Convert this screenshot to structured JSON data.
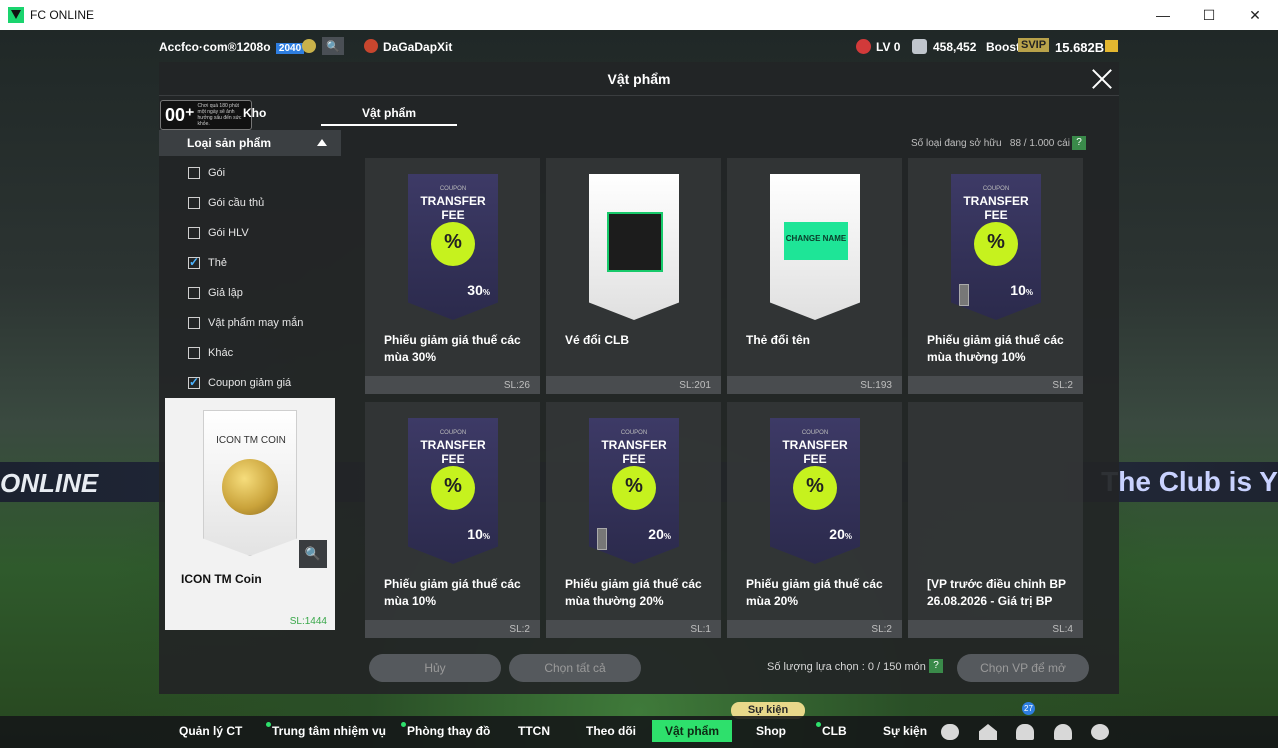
{
  "window": {
    "title": "FC ONLINE",
    "minimize": "—",
    "maximize": "☐",
    "close": "✕"
  },
  "background": {
    "banner_left": "ONLINE",
    "banner_right": "The Club is Y"
  },
  "topbar": {
    "account": "Accfco·com®1208o",
    "level_tag": "2040",
    "club": "DaGaDapXit",
    "lv": "LV 0",
    "mp": "458,452",
    "boost": "Boost",
    "svip": "SVIP",
    "coins": "15.682B"
  },
  "modal": {
    "title": "Vật phẩm",
    "age_rating": "00⁺",
    "age_notice": "Chơi quá 180 phút một ngày sẽ ảnh hưởng xấu đến sức khỏe.",
    "tab_kho": "Kho",
    "tab_vatpham": "Vật phẩm",
    "filter_title": "Loại sản phẩm",
    "filters": [
      {
        "label": "Gói",
        "checked": false
      },
      {
        "label": "Gói cầu thủ",
        "checked": false
      },
      {
        "label": "Gói HLV",
        "checked": false
      },
      {
        "label": "Thẻ",
        "checked": true
      },
      {
        "label": "Giả lập",
        "checked": false
      },
      {
        "label": "Vật phẩm may mắn",
        "checked": false
      },
      {
        "label": "Khác",
        "checked": false
      },
      {
        "label": "Coupon giảm giá",
        "checked": true
      }
    ],
    "detail": {
      "card_title": "ICON TM COIN",
      "name": "ICON TM Coin",
      "sl": "SL:1444"
    },
    "owned_label": "Số loại đang sở hữu",
    "owned_value": "88 / 1.000 cái",
    "help": "?",
    "items": [
      {
        "type": "coupon",
        "coupon": "COUPON",
        "tf": "TRANSFER FEE",
        "pct": "30",
        "name": "Phiếu giảm giá thuế các mùa 30%",
        "sl": "SL:26",
        "lock": false
      },
      {
        "type": "club",
        "name": "Vé đổi CLB",
        "sl": "SL:201"
      },
      {
        "type": "rename",
        "ticket": "CHANGE NAME",
        "name": "Thẻ đổi tên",
        "sl": "SL:193"
      },
      {
        "type": "coupon",
        "coupon": "COUPON",
        "tf": "TRANSFER FEE",
        "pct": "10",
        "name": "Phiếu giảm giá thuế các mùa thường 10%",
        "sl": "SL:2",
        "lock": true
      },
      {
        "type": "coupon",
        "coupon": "COUPON",
        "tf": "TRANSFER FEE",
        "pct": "10",
        "name": "Phiếu giảm giá thuế các mùa 10%",
        "sl": "SL:2",
        "lock": false
      },
      {
        "type": "coupon",
        "coupon": "COUPON",
        "tf": "TRANSFER FEE",
        "pct": "20",
        "name": "Phiếu giảm giá thuế các mùa thường 20%",
        "sl": "SL:1",
        "lock": true
      },
      {
        "type": "coupon",
        "coupon": "COUPON",
        "tf": "TRANSFER FEE",
        "pct": "20",
        "name": "Phiếu giảm giá thuế các mùa 20%",
        "sl": "SL:2",
        "lock": false
      },
      {
        "type": "text",
        "name": "[VP trước điều chỉnh BP 26.08.2026 - Giá trị BP",
        "sl": "SL:4"
      }
    ],
    "btn_cancel": "Hủy",
    "btn_select_all": "Chọn tất cả",
    "select_count": "Số lượng lựa chọn : 0 / 150 món",
    "btn_choose": "Chọn VP để mở"
  },
  "nav": {
    "event_pill": "Sự kiện",
    "items": [
      {
        "label": "Quản lý CT",
        "dot": false
      },
      {
        "label": "Trung tâm nhiệm vụ",
        "dot": true
      },
      {
        "label": "Phòng thay đồ",
        "dot": true
      },
      {
        "label": "TTCN",
        "dot": false
      },
      {
        "label": "Theo dõi",
        "dot": false
      },
      {
        "label": "Vật phẩm",
        "dot": false,
        "active": true
      },
      {
        "label": "Shop",
        "dot": false
      },
      {
        "label": "CLB",
        "dot": true
      },
      {
        "label": "Sự kiện",
        "dot": false
      }
    ],
    "notif_count": "27"
  }
}
